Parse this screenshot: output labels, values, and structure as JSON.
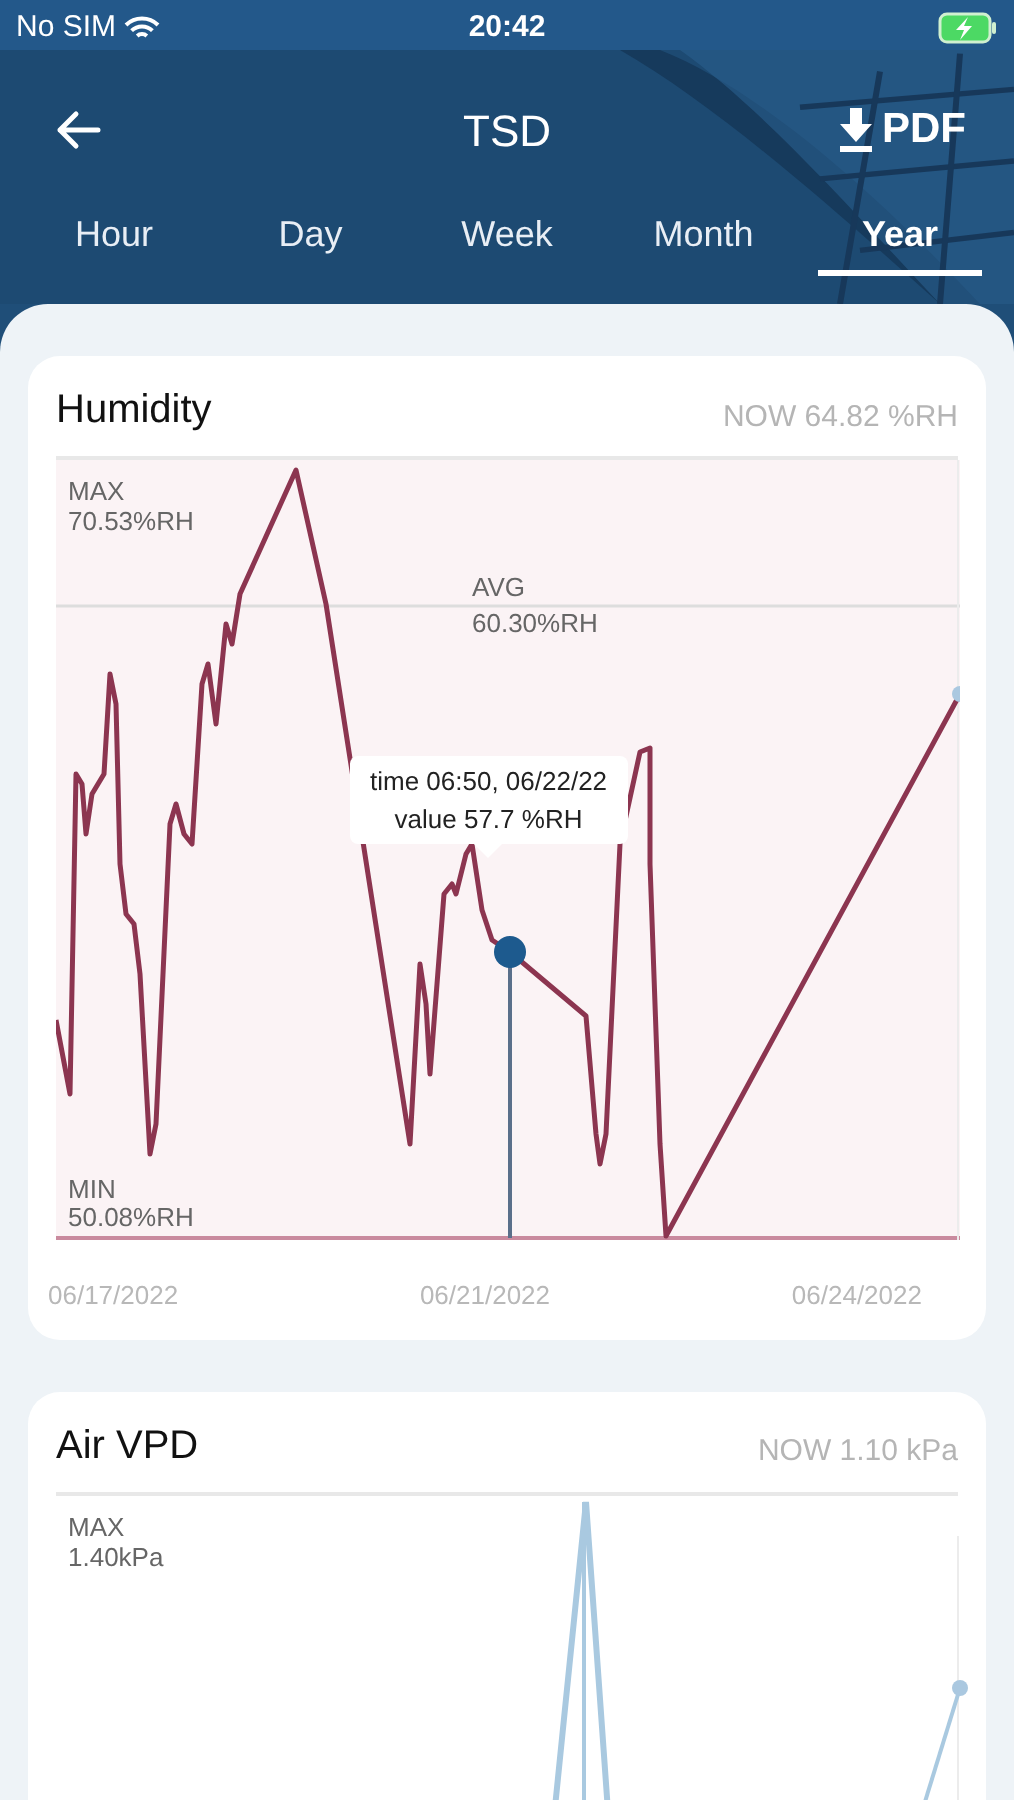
{
  "status_bar": {
    "carrier": "No SIM",
    "time": "20:42",
    "charging": true
  },
  "header": {
    "title": "TSD",
    "action": "PDF"
  },
  "tabs": [
    {
      "label": "Hour",
      "selected": false
    },
    {
      "label": "Day",
      "selected": false
    },
    {
      "label": "Week",
      "selected": false
    },
    {
      "label": "Month",
      "selected": false
    },
    {
      "label": "Year",
      "selected": true
    }
  ],
  "cards": [
    {
      "title": "Humidity",
      "now": "NOW 64.82 %RH",
      "max": {
        "label": "MAX",
        "value": "70.53%RH"
      },
      "avg": {
        "label": "AVG",
        "value": "60.30%RH"
      },
      "min": {
        "label": "MIN",
        "value": "50.08%RH"
      },
      "tooltip": [
        "time 06:50, 06/22/22",
        "value 57.7 %RH"
      ],
      "x_labels": [
        "06/17/2022",
        "06/21/2022",
        "06/24/2022"
      ]
    },
    {
      "title": "Air VPD",
      "now": "NOW 1.10 kPa",
      "max": {
        "label": "MAX",
        "value": "1.40kPa"
      }
    }
  ]
}
